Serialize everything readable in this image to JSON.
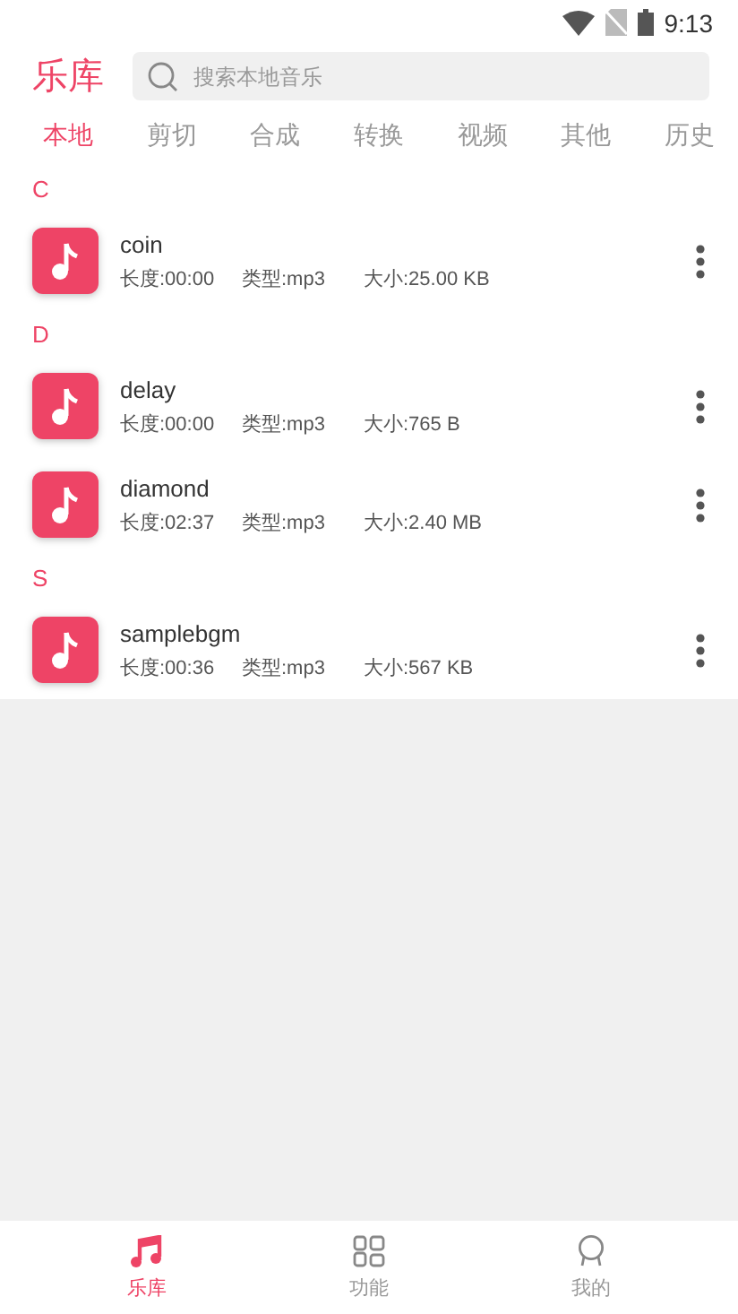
{
  "status_bar": {
    "time": "9:13"
  },
  "header": {
    "title": "乐库",
    "search": {
      "placeholder": "搜索本地音乐"
    }
  },
  "tabs": [
    {
      "label": "本地",
      "selected": true
    },
    {
      "label": "剪切",
      "selected": false
    },
    {
      "label": "合成",
      "selected": false
    },
    {
      "label": "转换",
      "selected": false
    },
    {
      "label": "视频",
      "selected": false
    },
    {
      "label": "其他",
      "selected": false
    },
    {
      "label": "历史",
      "selected": false
    }
  ],
  "sections": [
    {
      "letter": "C",
      "songs": [
        {
          "name": "coin",
          "duration": "长度:00:00",
          "type": "类型:mp3",
          "size": "大小:25.00 KB"
        }
      ]
    },
    {
      "letter": "D",
      "songs": [
        {
          "name": "delay",
          "duration": "长度:00:00",
          "type": "类型:mp3",
          "size": "大小:765 B"
        },
        {
          "name": "diamond",
          "duration": "长度:02:37",
          "type": "类型:mp3",
          "size": "大小:2.40 MB"
        }
      ]
    },
    {
      "letter": "S",
      "songs": [
        {
          "name": "samplebgm",
          "duration": "长度:00:36",
          "type": "类型:mp3",
          "size": "大小:567 KB"
        }
      ]
    }
  ],
  "bottom_nav": [
    {
      "label": "乐库",
      "kind": "library",
      "selected": true
    },
    {
      "label": "功能",
      "kind": "features",
      "selected": false
    },
    {
      "label": "我的",
      "kind": "profile",
      "selected": false
    }
  ]
}
